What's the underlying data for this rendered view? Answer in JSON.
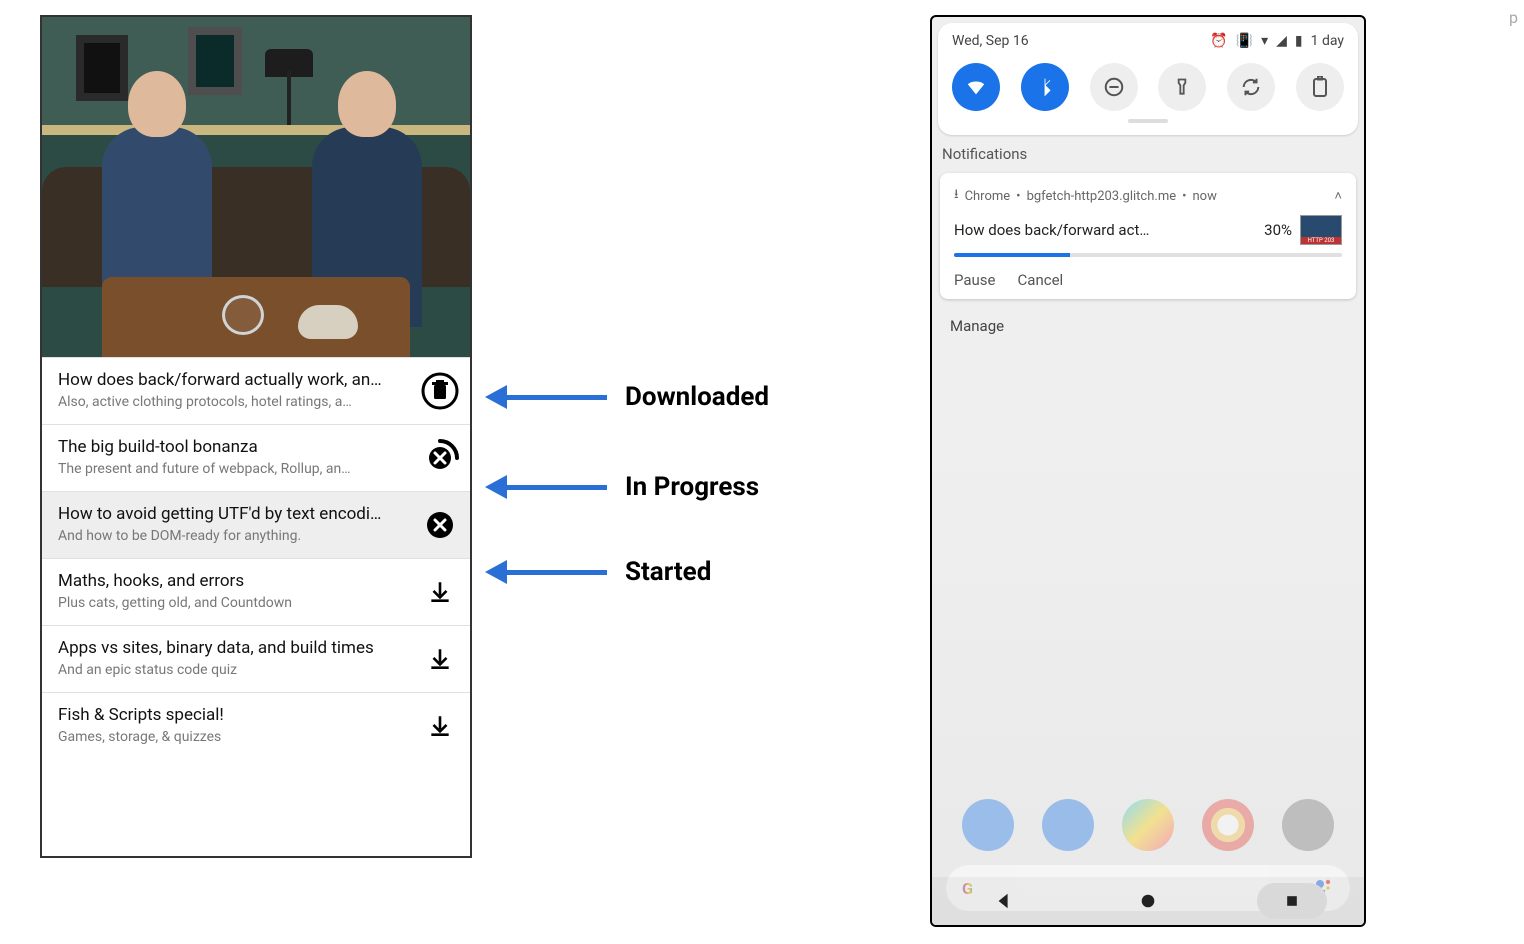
{
  "labels": {
    "downloaded": "Downloaded",
    "in_progress": "In Progress",
    "started": "Started"
  },
  "podcast_list": {
    "items": [
      {
        "title": "How does back/forward actually work, an…",
        "subtitle": "Also, active clothing protocols, hotel ratings, a…",
        "state": "downloaded"
      },
      {
        "title": "The big build-tool bonanza",
        "subtitle": "The present and future of webpack, Rollup, an…",
        "state": "in_progress"
      },
      {
        "title": "How to avoid getting UTF'd by text encodi…",
        "subtitle": "And how to be DOM-ready for anything.",
        "state": "started"
      },
      {
        "title": "Maths, hooks, and errors",
        "subtitle": "Plus cats, getting old, and Countdown",
        "state": "idle"
      },
      {
        "title": "Apps vs sites, binary data, and build times",
        "subtitle": "And an epic status code quiz",
        "state": "idle"
      },
      {
        "title": "Fish & Scripts special!",
        "subtitle": "Games, storage, & quizzes",
        "state": "idle"
      }
    ]
  },
  "android": {
    "status_bar": {
      "date": "Wed, Sep 16",
      "battery_text": "1 day"
    },
    "quick_settings": [
      {
        "name": "wifi",
        "on": true
      },
      {
        "name": "bluetooth",
        "on": true
      },
      {
        "name": "dnd",
        "on": false
      },
      {
        "name": "flashlight",
        "on": false
      },
      {
        "name": "autorotate",
        "on": false
      },
      {
        "name": "battery-saver",
        "on": false
      }
    ],
    "notifications_label": "Notifications",
    "notification": {
      "app": "Chrome",
      "source": "bgfetch-http203.glitch.me",
      "time": "now",
      "title": "How does back/forward act…",
      "percent": "30%",
      "progress": 30,
      "actions": {
        "pause": "Pause",
        "cancel": "Cancel"
      }
    },
    "manage_label": "Manage"
  },
  "stray_char": "p"
}
